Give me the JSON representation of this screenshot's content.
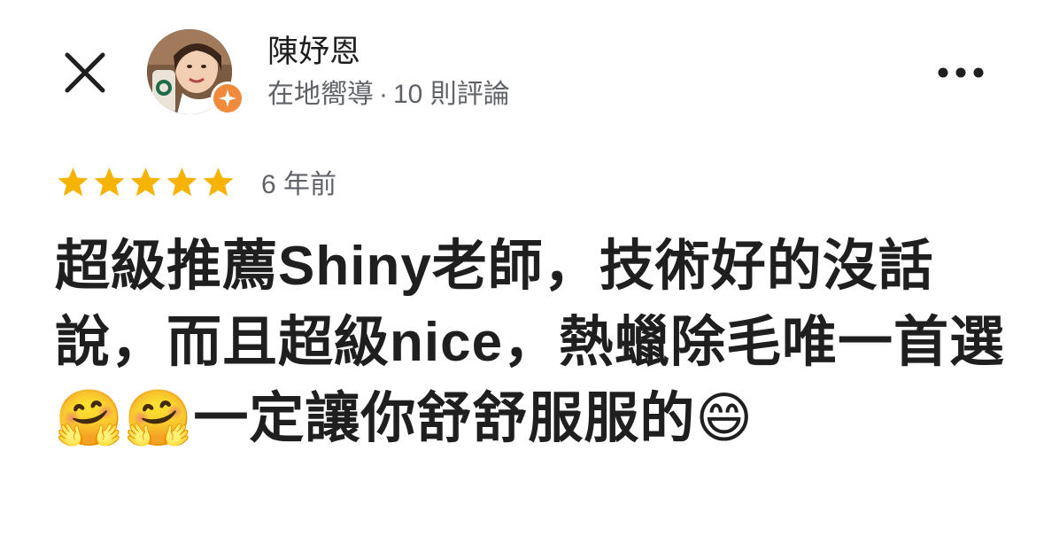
{
  "header": {
    "close_icon": "close-icon",
    "more_icon": "more-horizontal-icon"
  },
  "user": {
    "name": "陳妤恩",
    "badge": "在地嚮導",
    "separator": "·",
    "review_count": "10 則評論",
    "badge_icon": "local-guide-star-icon",
    "badge_color": "#f08a3c"
  },
  "review": {
    "rating": 5,
    "max_rating": 5,
    "star_color": "#f6b400",
    "age": "6 年前",
    "text": "超級推薦Shiny老師，技術好的沒話說，而且超級nice，熱蠟除毛唯一首選🤗🤗一定讓你舒舒服服的😄"
  }
}
